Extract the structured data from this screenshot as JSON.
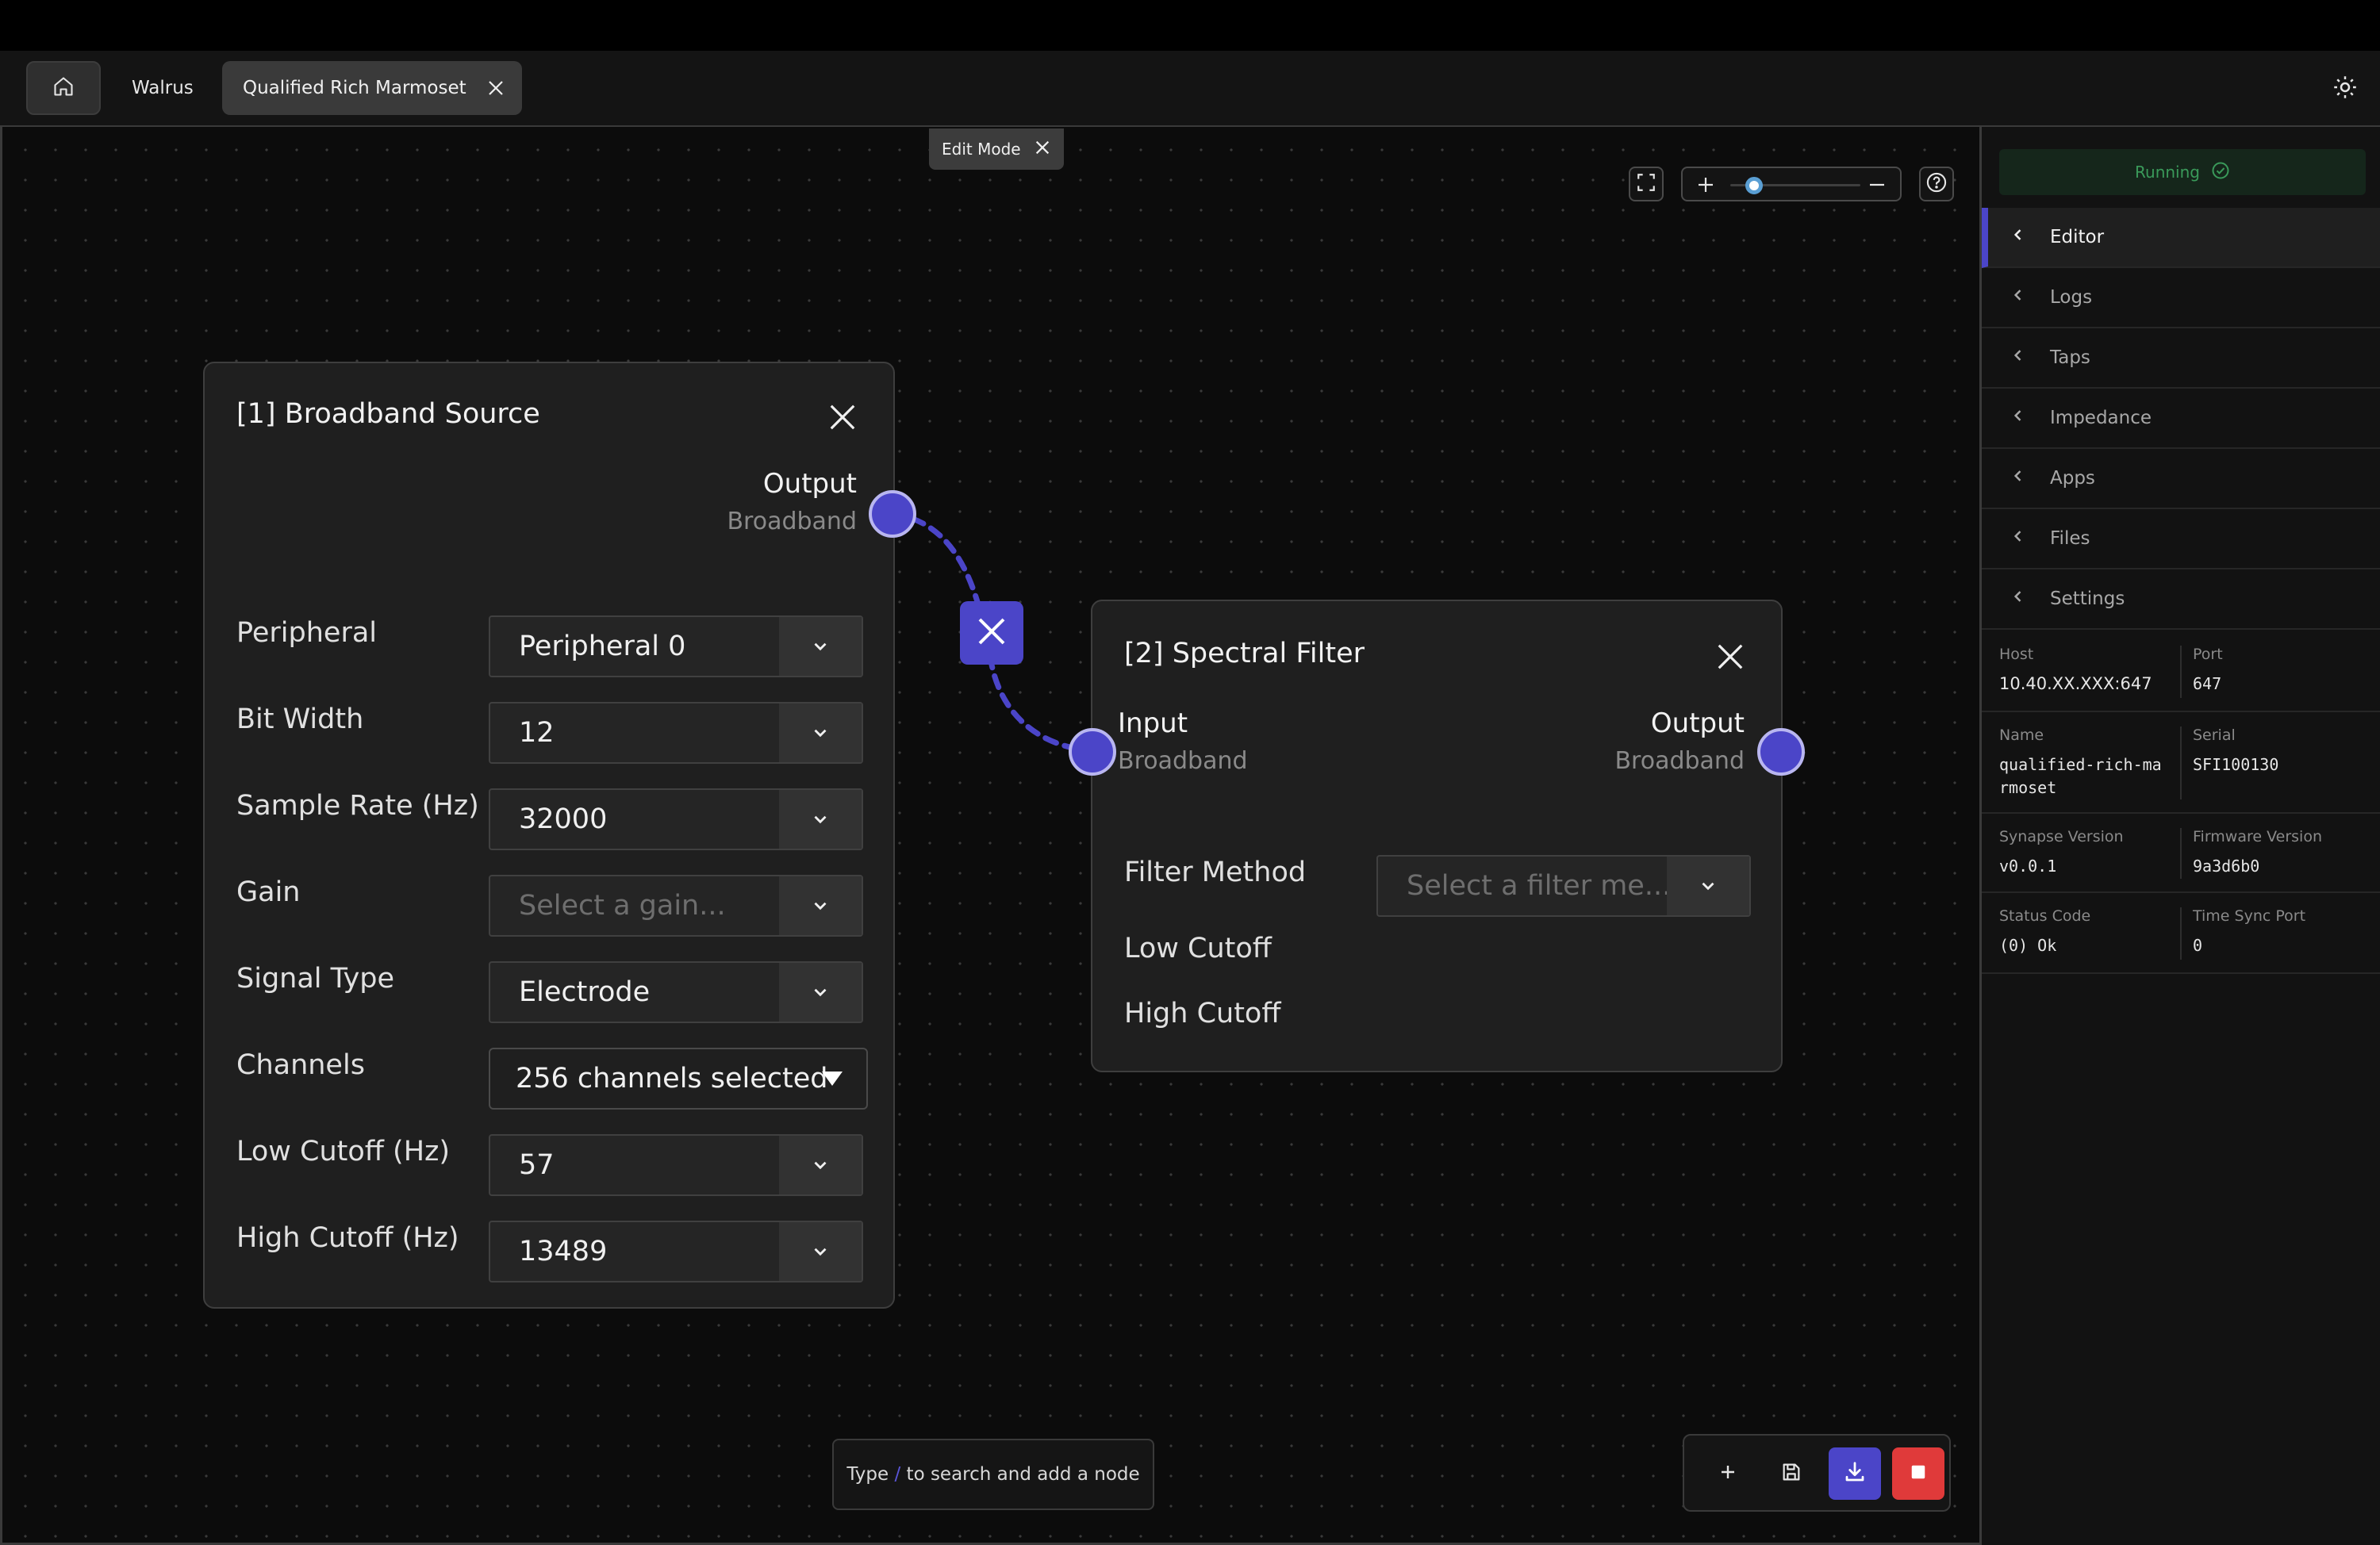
{
  "tabs": {
    "home_icon": "home-icon",
    "items": [
      {
        "label": "Walrus"
      },
      {
        "label": "Qualified Rich Marmoset"
      }
    ]
  },
  "canvas": {
    "edit_mode_label": "Edit Mode",
    "zoom_level": 0.18,
    "search_hint": {
      "prefix": "Type ",
      "key": "/",
      "suffix": " to search and add a node"
    }
  },
  "nodes": {
    "source": {
      "title": "[1] Broadband Source",
      "output": {
        "label": "Output",
        "type": "Broadband"
      },
      "fields": [
        {
          "label": "Peripheral",
          "value": "Peripheral 0"
        },
        {
          "label": "Bit Width",
          "value": "12"
        },
        {
          "label": "Sample Rate (Hz)",
          "value": "32000"
        },
        {
          "label": "Gain",
          "placeholder": "Select a gain..."
        },
        {
          "label": "Signal Type",
          "value": "Electrode"
        },
        {
          "label": "Channels",
          "value": "256 channels selected"
        },
        {
          "label": "Low Cutoff (Hz)",
          "value": "57"
        },
        {
          "label": "High Cutoff (Hz)",
          "value": "13489"
        }
      ]
    },
    "filter": {
      "title": "[2] Spectral Filter",
      "input": {
        "label": "Input",
        "type": "Broadband"
      },
      "output": {
        "label": "Output",
        "type": "Broadband"
      },
      "method_label": "Filter Method",
      "method_placeholder": "Select a filter me...",
      "low_cutoff_label": "Low Cutoff",
      "high_cutoff_label": "High Cutoff"
    }
  },
  "colors": {
    "accent": "#4b45c8",
    "stop": "#e03a3a",
    "running": "#3a9a5a"
  },
  "sidebar": {
    "status": "Running",
    "nav": [
      {
        "label": "Editor"
      },
      {
        "label": "Logs"
      },
      {
        "label": "Taps"
      },
      {
        "label": "Impedance"
      },
      {
        "label": "Apps"
      },
      {
        "label": "Files"
      },
      {
        "label": "Settings"
      }
    ],
    "info": {
      "host": {
        "label": "Host",
        "value": "10.40.XX.XXX:647"
      },
      "port": {
        "label": "Port",
        "value": "647"
      },
      "name": {
        "label": "Name",
        "value": "qualified-rich-marmoset"
      },
      "serial": {
        "label": "Serial",
        "value": "SFI100130"
      },
      "synapse_version": {
        "label": "Synapse Version",
        "value": "v0.0.1"
      },
      "firmware_version": {
        "label": "Firmware Version",
        "value": "9a3d6b0"
      },
      "status_code": {
        "label": "Status Code",
        "value": "(0) Ok"
      },
      "time_sync_port": {
        "label": "Time Sync Port",
        "value": "0"
      }
    }
  }
}
